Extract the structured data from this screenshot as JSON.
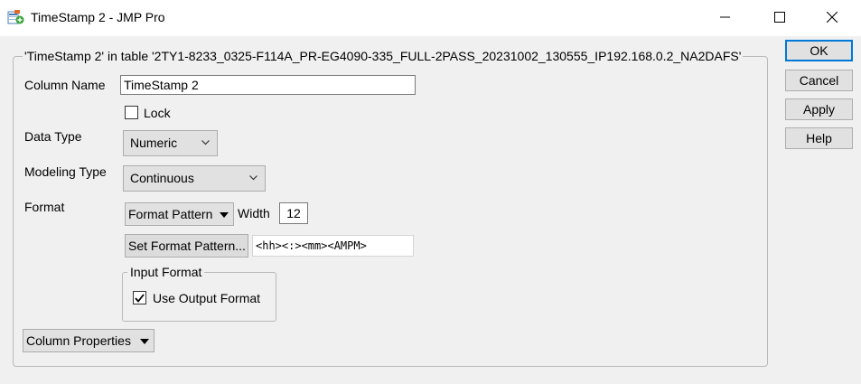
{
  "window": {
    "title": "TimeStamp 2 - JMP Pro",
    "controls": {
      "minimize": "minimize-icon",
      "maximize": "maximize-icon",
      "close": "close-icon"
    }
  },
  "dialog": {
    "group_title": "'TimeStamp 2' in table '2TY1-8233_0325-F114A_PR-EG4090-335_FULL-2PASS_20231002_130555_IP192.168.0.2_NA2DAFS'",
    "column_name_label": "Column Name",
    "column_name_value": "TimeStamp 2",
    "lock_label": "Lock",
    "lock_checked": false,
    "data_type_label": "Data Type",
    "data_type_value": "Numeric",
    "modeling_type_label": "Modeling Type",
    "modeling_type_value": "Continuous",
    "format_label": "Format",
    "format_value": "Format Pattern",
    "width_label": "Width",
    "width_value": "12",
    "set_format_button": "Set Format Pattern...",
    "format_pattern": "<hh><:><mm><AMPM>",
    "input_format_title": "Input Format",
    "use_output_format_label": "Use Output Format",
    "use_output_format_checked": true,
    "column_properties_button": "Column Properties"
  },
  "buttons": {
    "ok": "OK",
    "cancel": "Cancel",
    "apply": "Apply",
    "help": "Help"
  },
  "colors": {
    "background": "#f0f0f0",
    "button_face": "#e1e1e1",
    "default_button_border": "#0078d7"
  }
}
